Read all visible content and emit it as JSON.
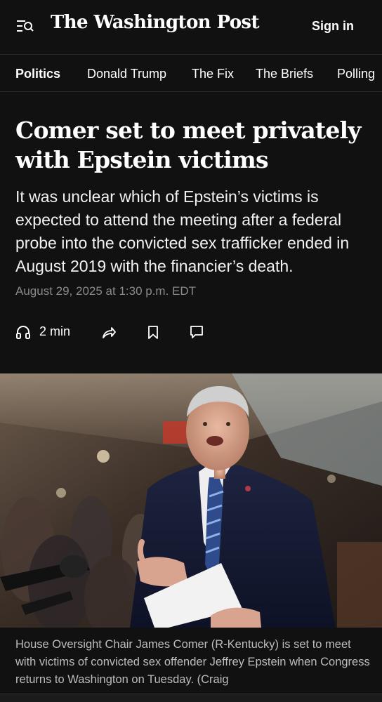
{
  "header": {
    "logo_text": "The Washington Post",
    "sign_in_label": "Sign in",
    "menu_icon": "menu-search-icon"
  },
  "nav": {
    "items": [
      {
        "label": "Politics",
        "active": true
      },
      {
        "label": "Donald Trump",
        "active": false
      },
      {
        "label": "The Fix",
        "active": false
      },
      {
        "label": "The Briefs",
        "active": false
      },
      {
        "label": "Polling",
        "active": false
      }
    ]
  },
  "article": {
    "headline_line1": "Comer set to meet privately",
    "headline_line2": "with Epstein victims",
    "dek": "It was unclear which of Epstein’s victims is expected to attend the meeting after a federal probe into the convicted sex trafficker ended in August 2019 with the financier’s death.",
    "date": "August 29, 2025 at 1:30 p.m. EDT",
    "listen_label": "2 min",
    "caption": "House Oversight Chair James Comer (R-Kentucky) is set to meet with victims of convicted sex offender Jeffrey Epstein when Congress returns to Washington on Tuesday. (Craig"
  },
  "icons": {
    "listen": "headphones-icon",
    "share": "share-icon",
    "save": "bookmark-icon",
    "comments": "comment-icon"
  },
  "colors": {
    "background": "#111111",
    "text": "#ffffff",
    "muted": "#8a8a8a",
    "caption": "#bdbdbd"
  }
}
